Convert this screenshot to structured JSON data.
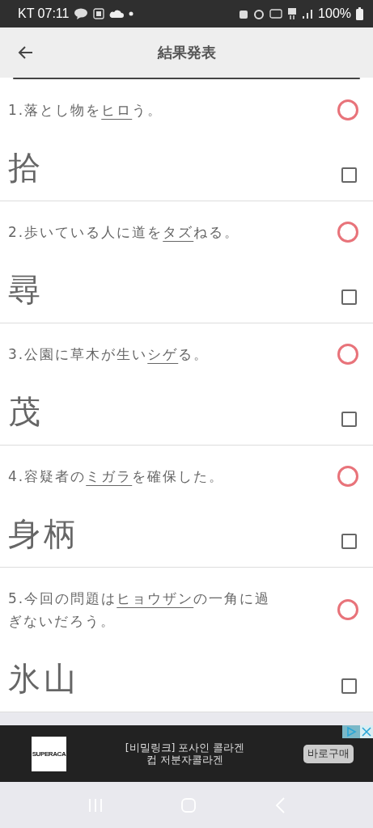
{
  "status_bar": {
    "carrier_time": "KT 07:11",
    "battery": "100%"
  },
  "app_bar": {
    "title": "結果発表"
  },
  "questions": [
    {
      "number": "1.",
      "before": "落とし物を",
      "target": "ヒロ",
      "after": "う。",
      "answer": "拾",
      "correct": true,
      "checked": false
    },
    {
      "number": "2.",
      "before": "歩いている人に道を",
      "target": "タズ",
      "after": "ねる。",
      "answer": "尋",
      "correct": true,
      "checked": false
    },
    {
      "number": "3.",
      "before": "公園に草木が生い",
      "target": "シゲ",
      "after": "る。",
      "answer": "茂",
      "correct": true,
      "checked": false
    },
    {
      "number": "4.",
      "before": "容疑者の",
      "target": "ミガラ",
      "after": "を確保した。",
      "answer": "身柄",
      "correct": true,
      "checked": false
    },
    {
      "number": "5.",
      "before": "今回の問題は",
      "target": "ヒョウザン",
      "after": "の一角に過ぎないだろう。",
      "answer": "氷山",
      "correct": true,
      "checked": false
    }
  ],
  "ad": {
    "logo": "SUPERACA",
    "text_lines": [
      "[비밀링크] 포사인 콜라겐",
      "컵 저분자콜라겐"
    ],
    "button": "바로구매"
  }
}
